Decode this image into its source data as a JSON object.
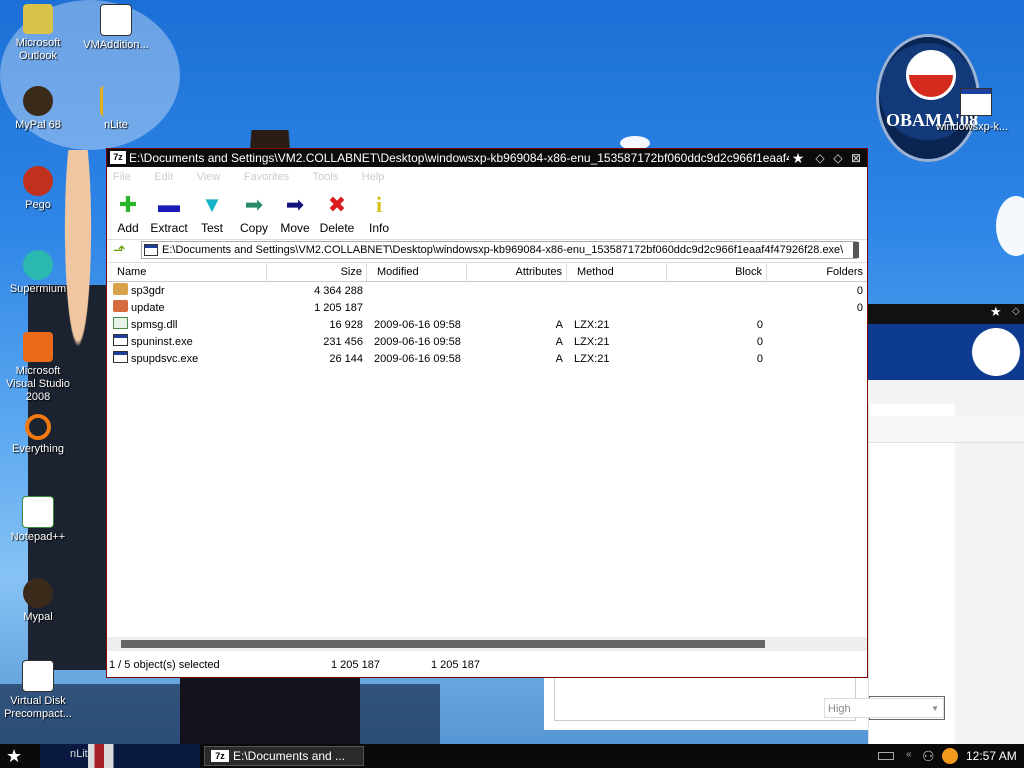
{
  "desktop": {
    "icons": [
      {
        "label": "Microsoft Outlook",
        "icon": "outlook-icon"
      },
      {
        "label": "VMAddition...",
        "icon": "vm-additions-icon"
      },
      {
        "label": "MyPal 68",
        "icon": "mypal-icon"
      },
      {
        "label": "nLite",
        "icon": "nlite-icon"
      },
      {
        "label": "Pego",
        "icon": "pego-icon"
      },
      {
        "label": "Supermium",
        "icon": "supermium-icon"
      },
      {
        "label": "Microsoft Visual Studio 2008",
        "icon": "visual-studio-icon"
      },
      {
        "label": "Everything",
        "icon": "everything-icon"
      },
      {
        "label": "Notepad++",
        "icon": "notepadpp-icon"
      },
      {
        "label": "Mypal",
        "icon": "mypal-icon"
      },
      {
        "label": "Virtual Disk Precompact...",
        "icon": "virtual-disk-icon"
      },
      {
        "label": "windowsxp-k...",
        "icon": "window-file-icon"
      }
    ],
    "badge_text": "OBAMA'08",
    "bg_window_select": "High"
  },
  "window": {
    "app_icon": "7z",
    "title": "E:\\Documents and Settings\\VM2.COLLABNET\\Desktop\\windowsxp-kb969084-x86-enu_153587172bf060ddc9d2c966f1eaaf4f4792...",
    "menu": [
      "File",
      "Edit",
      "View",
      "Favorites",
      "Tools",
      "Help"
    ],
    "toolbar": [
      {
        "label": "Add",
        "icon": "add-icon",
        "color": "#2bb52b",
        "glyph": "✚"
      },
      {
        "label": "Extract",
        "icon": "extract-icon",
        "color": "#1a1ab8",
        "glyph": "▬"
      },
      {
        "label": "Test",
        "icon": "test-icon",
        "color": "#19b3c9",
        "glyph": "▼"
      },
      {
        "label": "Copy",
        "icon": "copy-icon",
        "color": "#2a8a6a",
        "glyph": "➡"
      },
      {
        "label": "Move",
        "icon": "move-icon",
        "color": "#12127a",
        "glyph": "➡"
      },
      {
        "label": "Delete",
        "icon": "delete-icon",
        "color": "#d81b1b",
        "glyph": "✖"
      },
      {
        "label": "Info",
        "icon": "info-icon",
        "color": "#d8c21b",
        "glyph": "i"
      }
    ],
    "address": "E:\\Documents and Settings\\VM2.COLLABNET\\Desktop\\windowsxp-kb969084-x86-enu_153587172bf060ddc9d2c966f1eaaf4f47926f28.exe\\",
    "columns": [
      "Name",
      "Size",
      "Modified",
      "Attributes",
      "Method",
      "Block",
      "Folders"
    ],
    "rows": [
      {
        "name": "sp3gdr",
        "type": "folder",
        "size": "4 364 288",
        "modified": "",
        "attributes": "",
        "method": "",
        "block": "",
        "folders": "0"
      },
      {
        "name": "update",
        "type": "folder-red",
        "size": "1 205 187",
        "modified": "",
        "attributes": "",
        "method": "",
        "block": "",
        "folders": "0"
      },
      {
        "name": "spmsg.dll",
        "type": "dll",
        "size": "16 928",
        "modified": "2009-06-16 09:58",
        "attributes": "A",
        "method": "LZX:21",
        "block": "0",
        "folders": ""
      },
      {
        "name": "spuninst.exe",
        "type": "exe",
        "size": "231 456",
        "modified": "2009-06-16 09:58",
        "attributes": "A",
        "method": "LZX:21",
        "block": "0",
        "folders": ""
      },
      {
        "name": "spupdsvc.exe",
        "type": "exe",
        "size": "26 144",
        "modified": "2009-06-16 09:58",
        "attributes": "A",
        "method": "LZX:21",
        "block": "0",
        "folders": ""
      }
    ],
    "status": {
      "selected": "1 / 5 object(s) selected",
      "size": "1 205 187",
      "packed": "1 205 187"
    }
  },
  "taskbar": {
    "quick_label": "nLite",
    "task_icon": "7z",
    "task_label": "E:\\Documents and ...",
    "clock": "12:57 AM"
  }
}
